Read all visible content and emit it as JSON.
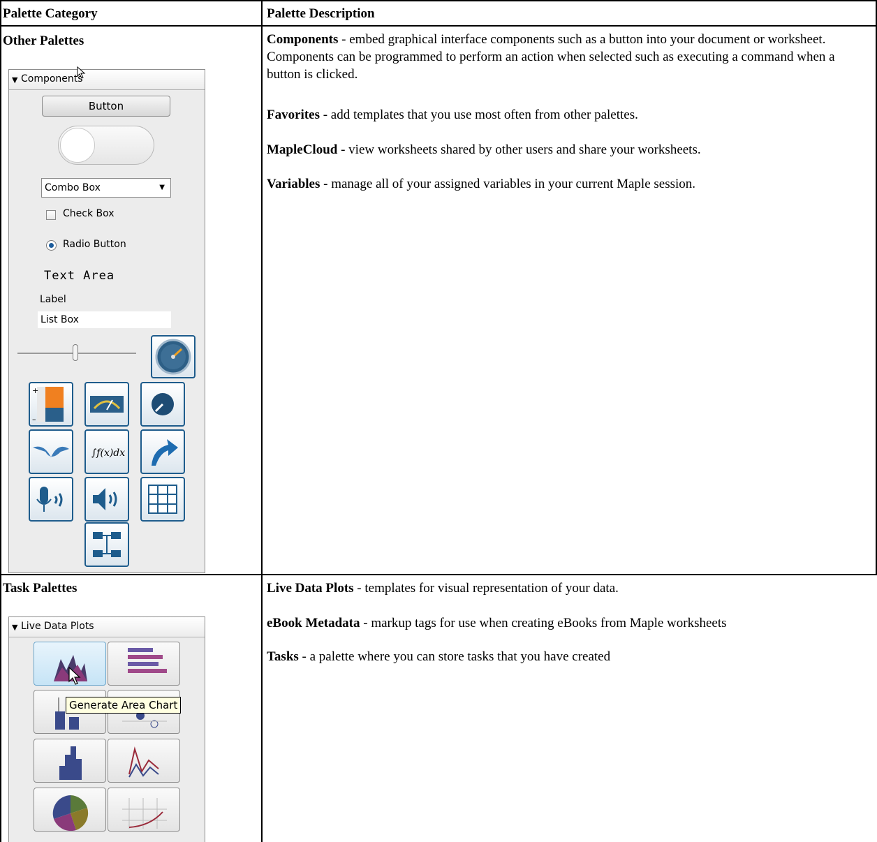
{
  "table": {
    "header": {
      "category": "Palette Category",
      "description": "Palette Description"
    },
    "rows": [
      {
        "category": "Other Palettes",
        "descriptions": [
          {
            "term": "Components",
            "text": " - embed graphical interface components such as a button into your document or worksheet. Components can be programmed to perform an action when selected such as executing a command when a button is clicked."
          },
          {
            "term": "Favorites",
            "text": " - add templates that you use most often from other palettes."
          },
          {
            "term": "MapleCloud",
            "text": " - view worksheets shared by other users and share your worksheets."
          },
          {
            "term": "Variables",
            "text": " - manage all of your assigned variables in your current Maple session."
          }
        ]
      },
      {
        "category": "Task Palettes",
        "descriptions": [
          {
            "term": "Live Data Plots",
            "text": " - templates for visual representation of your data."
          },
          {
            "term": "eBook Metadata",
            "text": " - markup tags for use when creating eBooks from Maple worksheets"
          },
          {
            "term": "Tasks",
            "text": " - a palette where you can store tasks that you have created"
          }
        ]
      }
    ]
  },
  "components_palette": {
    "title": "Components",
    "button_label": "Button",
    "combo_label": "Combo Box",
    "checkbox_label": "Check Box",
    "radio_label": "Radio Button",
    "textarea_label": "Text Area",
    "label_label": "Label",
    "listbox_label": "List Box",
    "icons": [
      "slider-icon",
      "gauge-icon",
      "volume-gauge-icon",
      "meter-icon",
      "dial-icon",
      "plot-icon",
      "math-container-icon",
      "rotate-arrow-icon",
      "microphone-icon",
      "speaker-icon",
      "data-table-icon",
      "code-edit-region-icon"
    ],
    "math_icon_text": "∫f(x)dx"
  },
  "live_data_palette": {
    "title": "Live Data Plots",
    "tooltip": "Generate Area Chart",
    "tiles": [
      "area-chart-icon",
      "bar-chart-icon",
      "box-plot-icon",
      "bubble-chart-icon",
      "histogram-icon",
      "line-chart-icon",
      "pie-chart-icon",
      "scatter-plot-icon"
    ]
  },
  "colors": {
    "border": "#000000",
    "icon_border": "#1e5c8c",
    "tooltip_bg": "#ffffe1"
  }
}
